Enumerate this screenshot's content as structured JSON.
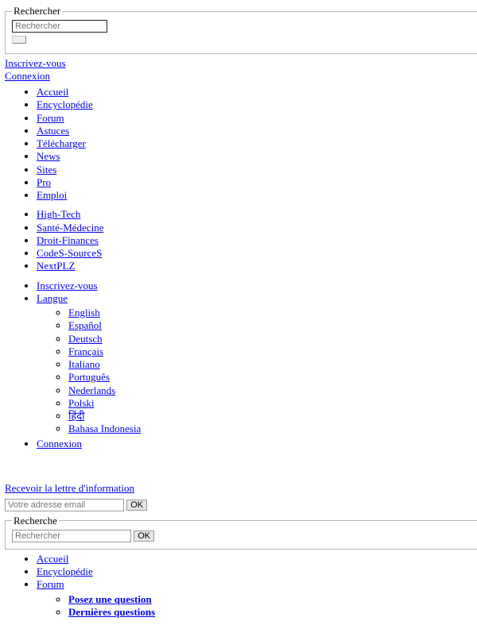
{
  "searchTop": {
    "legend": "Rechercher",
    "placeholder": "Rechercher"
  },
  "topLinks": {
    "signup": "Inscrivez-vous",
    "login": "Connexion"
  },
  "nav1": [
    "Accueil",
    "Encyclopédie",
    "Forum",
    "Astuces",
    "Télécharger",
    "News",
    "Sites",
    "Pro",
    "Emploi"
  ],
  "nav2": [
    "High-Tech",
    "Santé-Médecine",
    "Droit-Finances",
    "CodeS-SourceS",
    "NextPLZ"
  ],
  "account": {
    "signup": "Inscrivez-vous",
    "langLabel": "Langue",
    "languages": [
      "English",
      "Español",
      "Deutsch",
      "Français",
      "Italiano",
      "Português",
      "Nederlands",
      "Polski",
      "हिंदी",
      "Bahasa Indonesia"
    ],
    "login": "Connexion"
  },
  "newsletter": {
    "link": "Recevoir la lettre d'information",
    "placeholder": "Votre adresse email",
    "ok": "OK"
  },
  "searchBottom": {
    "legend": "Recherche",
    "placeholder": "Rechercher",
    "ok": "OK"
  },
  "nav3": {
    "items": [
      "Accueil",
      "Encyclopédie",
      "Forum"
    ],
    "forumSub": [
      "Posez une question",
      "Dernières questions"
    ]
  }
}
